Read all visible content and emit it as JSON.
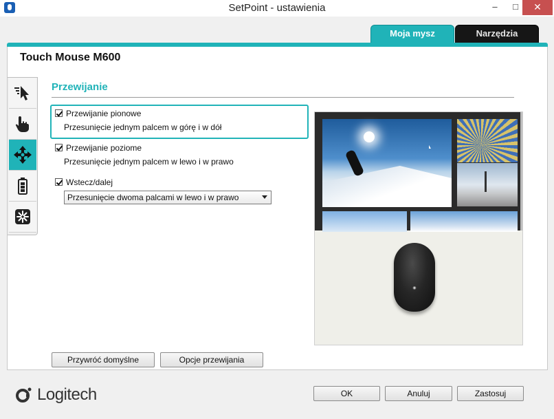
{
  "window": {
    "title": "SetPoint - ustawienia",
    "minimize": "–",
    "maximize": "□",
    "close": "✕"
  },
  "top_tabs": [
    {
      "label": "Moja mysz",
      "active": true
    },
    {
      "label": "Narzędzia",
      "active": false
    }
  ],
  "device": {
    "title": "Touch Mouse M600"
  },
  "side_tabs": [
    {
      "icon": "pointer-speed-icon",
      "active": false
    },
    {
      "icon": "touch-hand-icon",
      "active": false
    },
    {
      "icon": "scroll-move-icon",
      "active": true
    },
    {
      "icon": "battery-icon",
      "active": false
    },
    {
      "icon": "unifying-receiver-icon",
      "active": false
    }
  ],
  "section": {
    "title": "Przewijanie",
    "options": [
      {
        "label": "Przewijanie pionowe",
        "checked": true,
        "description": "Przesunięcie jednym palcem w górę i w dół"
      },
      {
        "label": "Przewijanie poziome",
        "checked": true,
        "description": "Przesunięcie jednym palcem w lewo i w prawo"
      },
      {
        "label": "Wstecz/dalej",
        "checked": true,
        "selected_value": "Przesunięcie dwoma palcami w lewo i w prawo"
      }
    ]
  },
  "buttons": {
    "restore": "Przywróć domyślne",
    "scroll_options": "Opcje przewijania",
    "ok": "OK",
    "cancel": "Anuluj",
    "apply": "Zastosuj"
  },
  "brand": {
    "logo": "Logitech",
    "accent_color": "#20b3b8"
  }
}
